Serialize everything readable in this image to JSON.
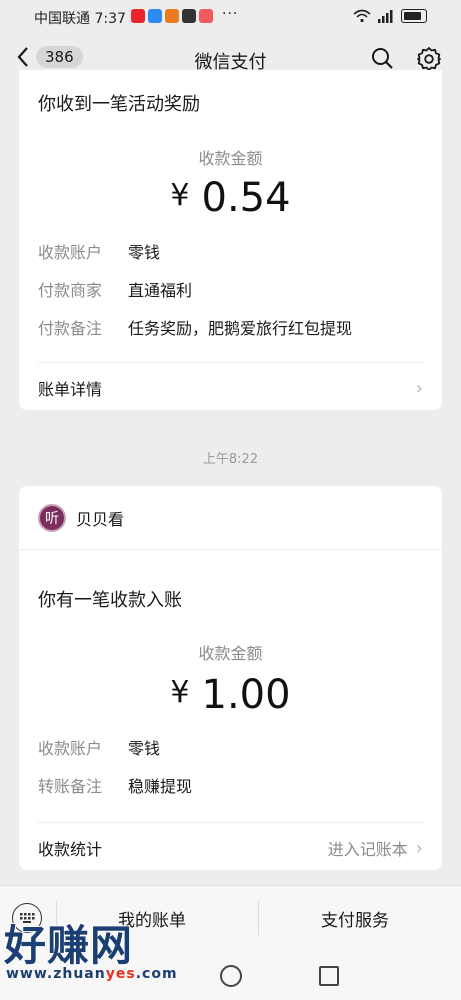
{
  "status_bar": {
    "carrier_time": "中国联通 7:37",
    "dots": "···",
    "battery_level": 0.85
  },
  "navbar": {
    "unread_count": "386",
    "title": "微信支付"
  },
  "card1": {
    "notice": "你收到一笔活动奖励",
    "amount_label": "收款金额",
    "currency": "¥",
    "amount": "0.54",
    "rows": [
      {
        "key": "收款账户",
        "value": "零钱"
      },
      {
        "key": "付款商家",
        "value": "直通福利"
      },
      {
        "key": "付款备注",
        "value": "任务奖励，肥鹅爱旅行红包提现"
      }
    ],
    "footer_label": "账单详情"
  },
  "time_separator": "上午8:22",
  "card2": {
    "merchant_logo_char": "听",
    "merchant_name": "贝贝看",
    "notice": "你有一笔收款入账",
    "amount_label": "收款金额",
    "currency": "¥",
    "amount": "1.00",
    "rows": [
      {
        "key": "收款账户",
        "value": "零钱"
      },
      {
        "key": "转账备注",
        "value": "稳赚提现"
      }
    ],
    "footer_label": "收款统计",
    "footer_link": "进入记账本"
  },
  "bottom_menu": {
    "items": [
      "我的账单",
      "支付服务"
    ]
  },
  "watermark": {
    "title": "好赚网",
    "url_prefix": "www.zhuan",
    "url_highlight": "yes",
    "url_suffix": ".com"
  },
  "colors": {
    "background": "#ededed",
    "card": "#ffffff",
    "muted_text": "#8c8c8c",
    "merchant_logo": "#7a2f5e"
  }
}
